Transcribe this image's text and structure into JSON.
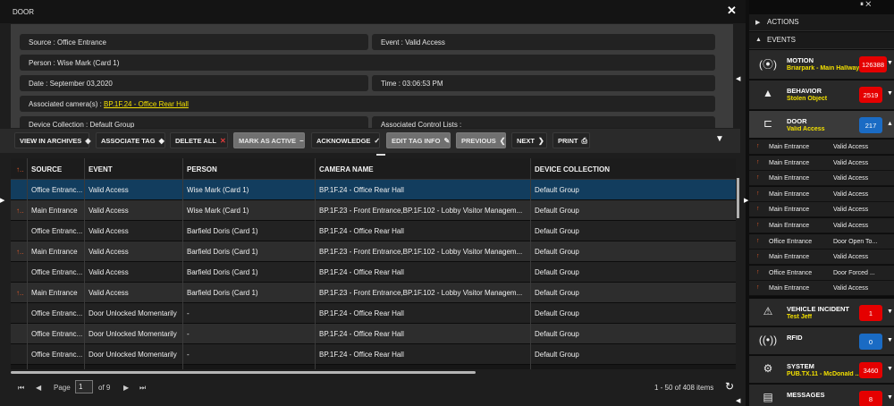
{
  "modal": {
    "title": "DOOR",
    "details": {
      "source": "Source  : Office Entrance",
      "event": "Event  : Valid Access",
      "person": "Person  : Wise Mark (Card 1)",
      "date": "Date  : September 03,2020",
      "time": "Time  : 03:06:53 PM",
      "cameras_label": "Associated camera(s)  :",
      "cameras_link": "BP.1F.24 - Office Rear Hall",
      "device_collection": "Device Collection  : Default Group",
      "control_lists": "Associated Control Lists  :"
    },
    "toolbar": {
      "view_in_archives": "VIEW IN ARCHIVES",
      "associate_tag": "ASSOCIATE TAG",
      "delete_all": "DELETE ALL",
      "mark_as_active": "MARK AS ACTIVE",
      "acknowledge": "ACKNOWLEDGE",
      "edit_tag_info": "EDIT TAG INFO",
      "previous": "PREVIOUS",
      "next": "NEXT",
      "print": "PRINT"
    },
    "grid": {
      "headers": [
        "SOURCE",
        "EVENT",
        "PERSON",
        "CAMERA NAME",
        "DEVICE COLLECTION"
      ],
      "rows": [
        {
          "flag": false,
          "source": "Office Entranc...",
          "event": "Valid Access",
          "person": "Wise Mark (Card 1)",
          "camera": "BP.1F.24 - Office Rear Hall",
          "collection": "Default Group"
        },
        {
          "flag": true,
          "source": "Main Entrance",
          "event": "Valid Access",
          "person": "Wise Mark (Card 1)",
          "camera": "BP.1F.23 - Front Entrance,BP.1F.102 - Lobby Visitor Managem...",
          "collection": "Default Group"
        },
        {
          "flag": false,
          "source": "Office Entranc...",
          "event": "Valid Access",
          "person": "Barfield Doris (Card 1)",
          "camera": "BP.1F.24 - Office Rear Hall",
          "collection": "Default Group"
        },
        {
          "flag": true,
          "source": "Main Entrance",
          "event": "Valid Access",
          "person": "Barfield Doris (Card 1)",
          "camera": "BP.1F.23 - Front Entrance,BP.1F.102 - Lobby Visitor Managem...",
          "collection": "Default Group"
        },
        {
          "flag": false,
          "source": "Office Entranc...",
          "event": "Valid Access",
          "person": "Barfield Doris (Card 1)",
          "camera": "BP.1F.24 - Office Rear Hall",
          "collection": "Default Group"
        },
        {
          "flag": true,
          "source": "Main Entrance",
          "event": "Valid Access",
          "person": "Barfield Doris (Card 1)",
          "camera": "BP.1F.23 - Front Entrance,BP.1F.102 - Lobby Visitor Managem...",
          "collection": "Default Group"
        },
        {
          "flag": false,
          "source": "Office Entranc...",
          "event": "Door Unlocked Momentarily",
          "person": "-",
          "camera": "BP.1F.24 - Office Rear Hall",
          "collection": "Default Group"
        },
        {
          "flag": false,
          "source": "Office Entranc...",
          "event": "Door Unlocked Momentarily",
          "person": "-",
          "camera": "BP.1F.24 - Office Rear Hall",
          "collection": "Default Group"
        },
        {
          "flag": false,
          "source": "Office Entranc...",
          "event": "Door Unlocked Momentarily",
          "person": "-",
          "camera": "BP.1F.24 - Office Rear Hall",
          "collection": "Default Group"
        }
      ]
    },
    "pager": {
      "page_label": "Page",
      "page_value": "1",
      "of_pages": "of 9",
      "items_info": "1 - 50 of 408 items"
    }
  },
  "panel": {
    "actions_label": "ACTIONS",
    "events_label": "EVENTS",
    "categories_top": [
      {
        "name": "MOTION",
        "sub": "Briarpark - Main Hallway",
        "count": "126388",
        "color": "red",
        "icon": "motion-sensor-icon"
      },
      {
        "name": "BEHAVIOR",
        "sub": "Stolen Object",
        "count": "2519",
        "color": "red",
        "icon": "warning-icon"
      },
      {
        "name": "DOOR",
        "sub": "Valid Access",
        "count": "217",
        "color": "blue",
        "icon": "door-icon"
      }
    ],
    "door_events": [
      {
        "flag": true,
        "source": "Main Entrance",
        "event": "Valid Access"
      },
      {
        "flag": true,
        "source": "Main Entrance",
        "event": "Valid Access"
      },
      {
        "flag": true,
        "source": "Main Entrance",
        "event": "Valid Access"
      },
      {
        "flag": true,
        "source": "Main Entrance",
        "event": "Valid Access"
      },
      {
        "flag": true,
        "source": "Main Entrance",
        "event": "Valid Access"
      },
      {
        "flag": true,
        "source": "Main Entrance",
        "event": "Valid Access"
      },
      {
        "flag": true,
        "source": "Office Entrance",
        "event": "Door Open To..."
      },
      {
        "flag": true,
        "source": "Main Entrance",
        "event": "Valid Access"
      },
      {
        "flag": true,
        "source": "Office Entrance",
        "event": "Door Forced ..."
      },
      {
        "flag": true,
        "source": "Main Entrance",
        "event": "Valid Access"
      }
    ],
    "categories_bottom": [
      {
        "name": "VEHICLE INCIDENT",
        "sub": "Test Jeff",
        "count": "1",
        "color": "red",
        "icon": "vehicle-icon"
      },
      {
        "name": "RFID",
        "sub": "",
        "count": "0",
        "color": "blue",
        "icon": "rfid-icon"
      },
      {
        "name": "SYSTEM",
        "sub": "PUB.TX.11 - McDonald ...",
        "count": "3460",
        "color": "red",
        "icon": "system-gear-icon"
      },
      {
        "name": "MESSAGES",
        "sub": "",
        "count": "8",
        "color": "red",
        "icon": "messages-icon"
      }
    ]
  }
}
